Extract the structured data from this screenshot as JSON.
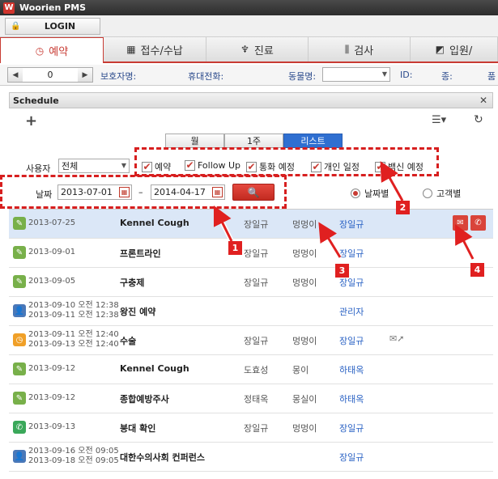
{
  "app": {
    "title": "Woorien PMS",
    "logo_letter": "W"
  },
  "login": {
    "label": "LOGIN"
  },
  "tabs": [
    {
      "label": "예약",
      "icon": "clock-icon"
    },
    {
      "label": "접수/수납",
      "icon": "register-icon"
    },
    {
      "label": "진료",
      "icon": "stethoscope-icon"
    },
    {
      "label": "검사",
      "icon": "test-tube-icon"
    },
    {
      "label": "입원/",
      "icon": "chart-icon"
    }
  ],
  "infobar": {
    "page_value": "0",
    "guardian_phone_label": "보호자명:",
    "mobile_label": "휴대전화:",
    "pet_name_label": "동물명:",
    "id_label": "ID:",
    "species_label": "종:",
    "breed_label": "품"
  },
  "schedule": {
    "header": "Schedule",
    "view_tabs": [
      "월",
      "1주",
      "리스트"
    ],
    "active_view": "리스트",
    "user_label": "사용자",
    "user_value": "전체",
    "checkboxes": [
      "예약",
      "Follow Up",
      "통화 예정",
      "개인 일정",
      "백신 예정"
    ],
    "date_label": "날짜",
    "date_from": "2013-07-01",
    "date_sep": "–",
    "date_to": "2014-04-17",
    "radio_by_date": "날짜별",
    "radio_by_customer": "고객별"
  },
  "rows": [
    {
      "type": "followup",
      "date1": "2013-07-25",
      "date2": "",
      "title": "Kennel Cough",
      "doctor": "장일규",
      "pet": "멍멍이",
      "owner": "장일규",
      "extra": ""
    },
    {
      "type": "followup",
      "date1": "2013-09-01",
      "date2": "",
      "title": "프론트라인",
      "doctor": "장일규",
      "pet": "멍멍이",
      "owner": "장일규",
      "extra": ""
    },
    {
      "type": "followup",
      "date1": "2013-09-05",
      "date2": "",
      "title": "구충제",
      "doctor": "장일규",
      "pet": "멍멍이",
      "owner": "장일규",
      "extra": ""
    },
    {
      "type": "personal",
      "date1": "2013-09-10 오전 12:38",
      "date2": "2013-09-11 오전 12:38",
      "title": "왕진 예약",
      "doctor": "",
      "pet": "",
      "owner": "관리자",
      "extra": ""
    },
    {
      "type": "reservation",
      "date1": "2013-09-11 오전 12:40",
      "date2": "2013-09-13 오전 12:40",
      "title": "수술",
      "doctor": "장일규",
      "pet": "멍멍이",
      "owner": "장일규",
      "extra": "sms"
    },
    {
      "type": "followup",
      "date1": "2013-09-12",
      "date2": "",
      "title": "Kennel Cough",
      "doctor": "도효성",
      "pet": "몽이",
      "owner": "하태옥",
      "extra": ""
    },
    {
      "type": "followup",
      "date1": "2013-09-12",
      "date2": "",
      "title": "종합예방주사",
      "doctor": "정태옥",
      "pet": "몽실이",
      "owner": "하태옥",
      "extra": ""
    },
    {
      "type": "call",
      "date1": "2013-09-13",
      "date2": "",
      "title": "붕대 확인",
      "doctor": "장일규",
      "pet": "멍멍이",
      "owner": "장일규",
      "extra": ""
    },
    {
      "type": "personal",
      "date1": "2013-09-16 오전 09:05",
      "date2": "2013-09-18 오전 09:05",
      "title": "대한수의사회 컨퍼런스",
      "doctor": "",
      "pet": "",
      "owner": "장일규",
      "extra": ""
    }
  ],
  "callouts": [
    "1",
    "2",
    "3",
    "4"
  ],
  "colors": {
    "accent": "#c83b33",
    "followup": "#78b04a",
    "personal": "#4a78b8",
    "reservation": "#f0a028",
    "call": "#3aa85a",
    "owner_link": "#2a62c4"
  }
}
